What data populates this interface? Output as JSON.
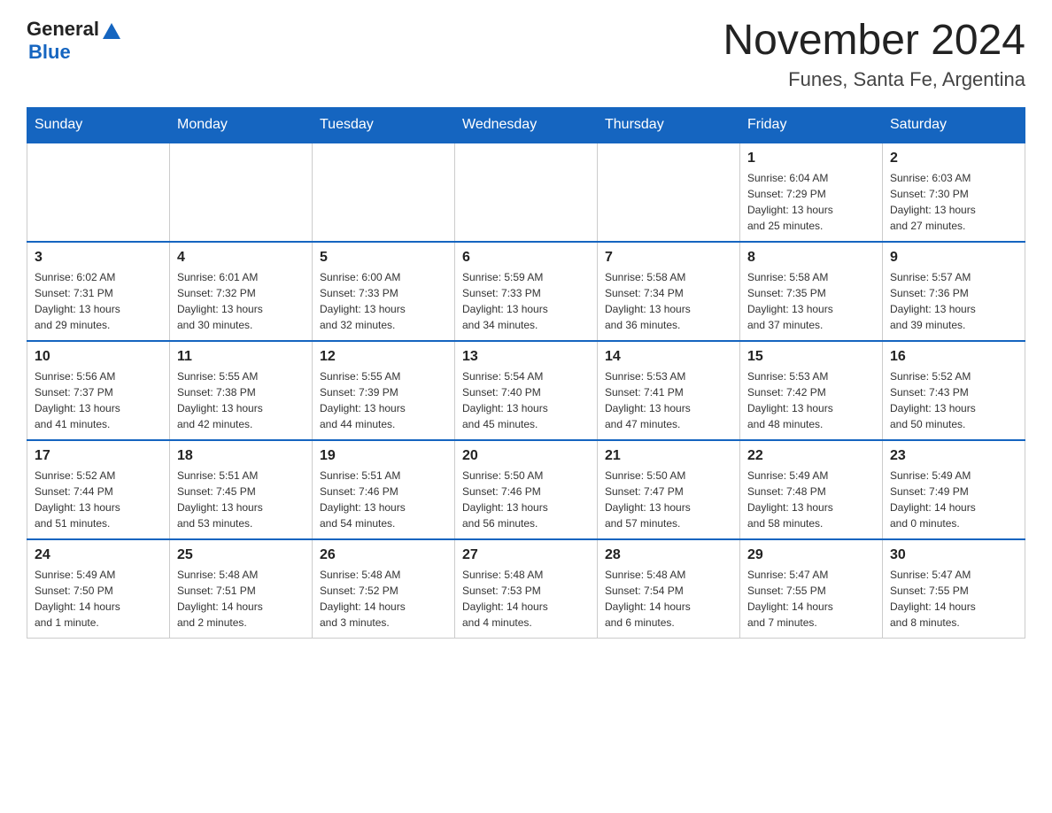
{
  "header": {
    "logo_general": "General",
    "logo_blue": "Blue",
    "month_title": "November 2024",
    "location": "Funes, Santa Fe, Argentina"
  },
  "days_of_week": [
    "Sunday",
    "Monday",
    "Tuesday",
    "Wednesday",
    "Thursday",
    "Friday",
    "Saturday"
  ],
  "weeks": [
    [
      {
        "day": "",
        "info": ""
      },
      {
        "day": "",
        "info": ""
      },
      {
        "day": "",
        "info": ""
      },
      {
        "day": "",
        "info": ""
      },
      {
        "day": "",
        "info": ""
      },
      {
        "day": "1",
        "info": "Sunrise: 6:04 AM\nSunset: 7:29 PM\nDaylight: 13 hours\nand 25 minutes."
      },
      {
        "day": "2",
        "info": "Sunrise: 6:03 AM\nSunset: 7:30 PM\nDaylight: 13 hours\nand 27 minutes."
      }
    ],
    [
      {
        "day": "3",
        "info": "Sunrise: 6:02 AM\nSunset: 7:31 PM\nDaylight: 13 hours\nand 29 minutes."
      },
      {
        "day": "4",
        "info": "Sunrise: 6:01 AM\nSunset: 7:32 PM\nDaylight: 13 hours\nand 30 minutes."
      },
      {
        "day": "5",
        "info": "Sunrise: 6:00 AM\nSunset: 7:33 PM\nDaylight: 13 hours\nand 32 minutes."
      },
      {
        "day": "6",
        "info": "Sunrise: 5:59 AM\nSunset: 7:33 PM\nDaylight: 13 hours\nand 34 minutes."
      },
      {
        "day": "7",
        "info": "Sunrise: 5:58 AM\nSunset: 7:34 PM\nDaylight: 13 hours\nand 36 minutes."
      },
      {
        "day": "8",
        "info": "Sunrise: 5:58 AM\nSunset: 7:35 PM\nDaylight: 13 hours\nand 37 minutes."
      },
      {
        "day": "9",
        "info": "Sunrise: 5:57 AM\nSunset: 7:36 PM\nDaylight: 13 hours\nand 39 minutes."
      }
    ],
    [
      {
        "day": "10",
        "info": "Sunrise: 5:56 AM\nSunset: 7:37 PM\nDaylight: 13 hours\nand 41 minutes."
      },
      {
        "day": "11",
        "info": "Sunrise: 5:55 AM\nSunset: 7:38 PM\nDaylight: 13 hours\nand 42 minutes."
      },
      {
        "day": "12",
        "info": "Sunrise: 5:55 AM\nSunset: 7:39 PM\nDaylight: 13 hours\nand 44 minutes."
      },
      {
        "day": "13",
        "info": "Sunrise: 5:54 AM\nSunset: 7:40 PM\nDaylight: 13 hours\nand 45 minutes."
      },
      {
        "day": "14",
        "info": "Sunrise: 5:53 AM\nSunset: 7:41 PM\nDaylight: 13 hours\nand 47 minutes."
      },
      {
        "day": "15",
        "info": "Sunrise: 5:53 AM\nSunset: 7:42 PM\nDaylight: 13 hours\nand 48 minutes."
      },
      {
        "day": "16",
        "info": "Sunrise: 5:52 AM\nSunset: 7:43 PM\nDaylight: 13 hours\nand 50 minutes."
      }
    ],
    [
      {
        "day": "17",
        "info": "Sunrise: 5:52 AM\nSunset: 7:44 PM\nDaylight: 13 hours\nand 51 minutes."
      },
      {
        "day": "18",
        "info": "Sunrise: 5:51 AM\nSunset: 7:45 PM\nDaylight: 13 hours\nand 53 minutes."
      },
      {
        "day": "19",
        "info": "Sunrise: 5:51 AM\nSunset: 7:46 PM\nDaylight: 13 hours\nand 54 minutes."
      },
      {
        "day": "20",
        "info": "Sunrise: 5:50 AM\nSunset: 7:46 PM\nDaylight: 13 hours\nand 56 minutes."
      },
      {
        "day": "21",
        "info": "Sunrise: 5:50 AM\nSunset: 7:47 PM\nDaylight: 13 hours\nand 57 minutes."
      },
      {
        "day": "22",
        "info": "Sunrise: 5:49 AM\nSunset: 7:48 PM\nDaylight: 13 hours\nand 58 minutes."
      },
      {
        "day": "23",
        "info": "Sunrise: 5:49 AM\nSunset: 7:49 PM\nDaylight: 14 hours\nand 0 minutes."
      }
    ],
    [
      {
        "day": "24",
        "info": "Sunrise: 5:49 AM\nSunset: 7:50 PM\nDaylight: 14 hours\nand 1 minute."
      },
      {
        "day": "25",
        "info": "Sunrise: 5:48 AM\nSunset: 7:51 PM\nDaylight: 14 hours\nand 2 minutes."
      },
      {
        "day": "26",
        "info": "Sunrise: 5:48 AM\nSunset: 7:52 PM\nDaylight: 14 hours\nand 3 minutes."
      },
      {
        "day": "27",
        "info": "Sunrise: 5:48 AM\nSunset: 7:53 PM\nDaylight: 14 hours\nand 4 minutes."
      },
      {
        "day": "28",
        "info": "Sunrise: 5:48 AM\nSunset: 7:54 PM\nDaylight: 14 hours\nand 6 minutes."
      },
      {
        "day": "29",
        "info": "Sunrise: 5:47 AM\nSunset: 7:55 PM\nDaylight: 14 hours\nand 7 minutes."
      },
      {
        "day": "30",
        "info": "Sunrise: 5:47 AM\nSunset: 7:55 PM\nDaylight: 14 hours\nand 8 minutes."
      }
    ]
  ]
}
